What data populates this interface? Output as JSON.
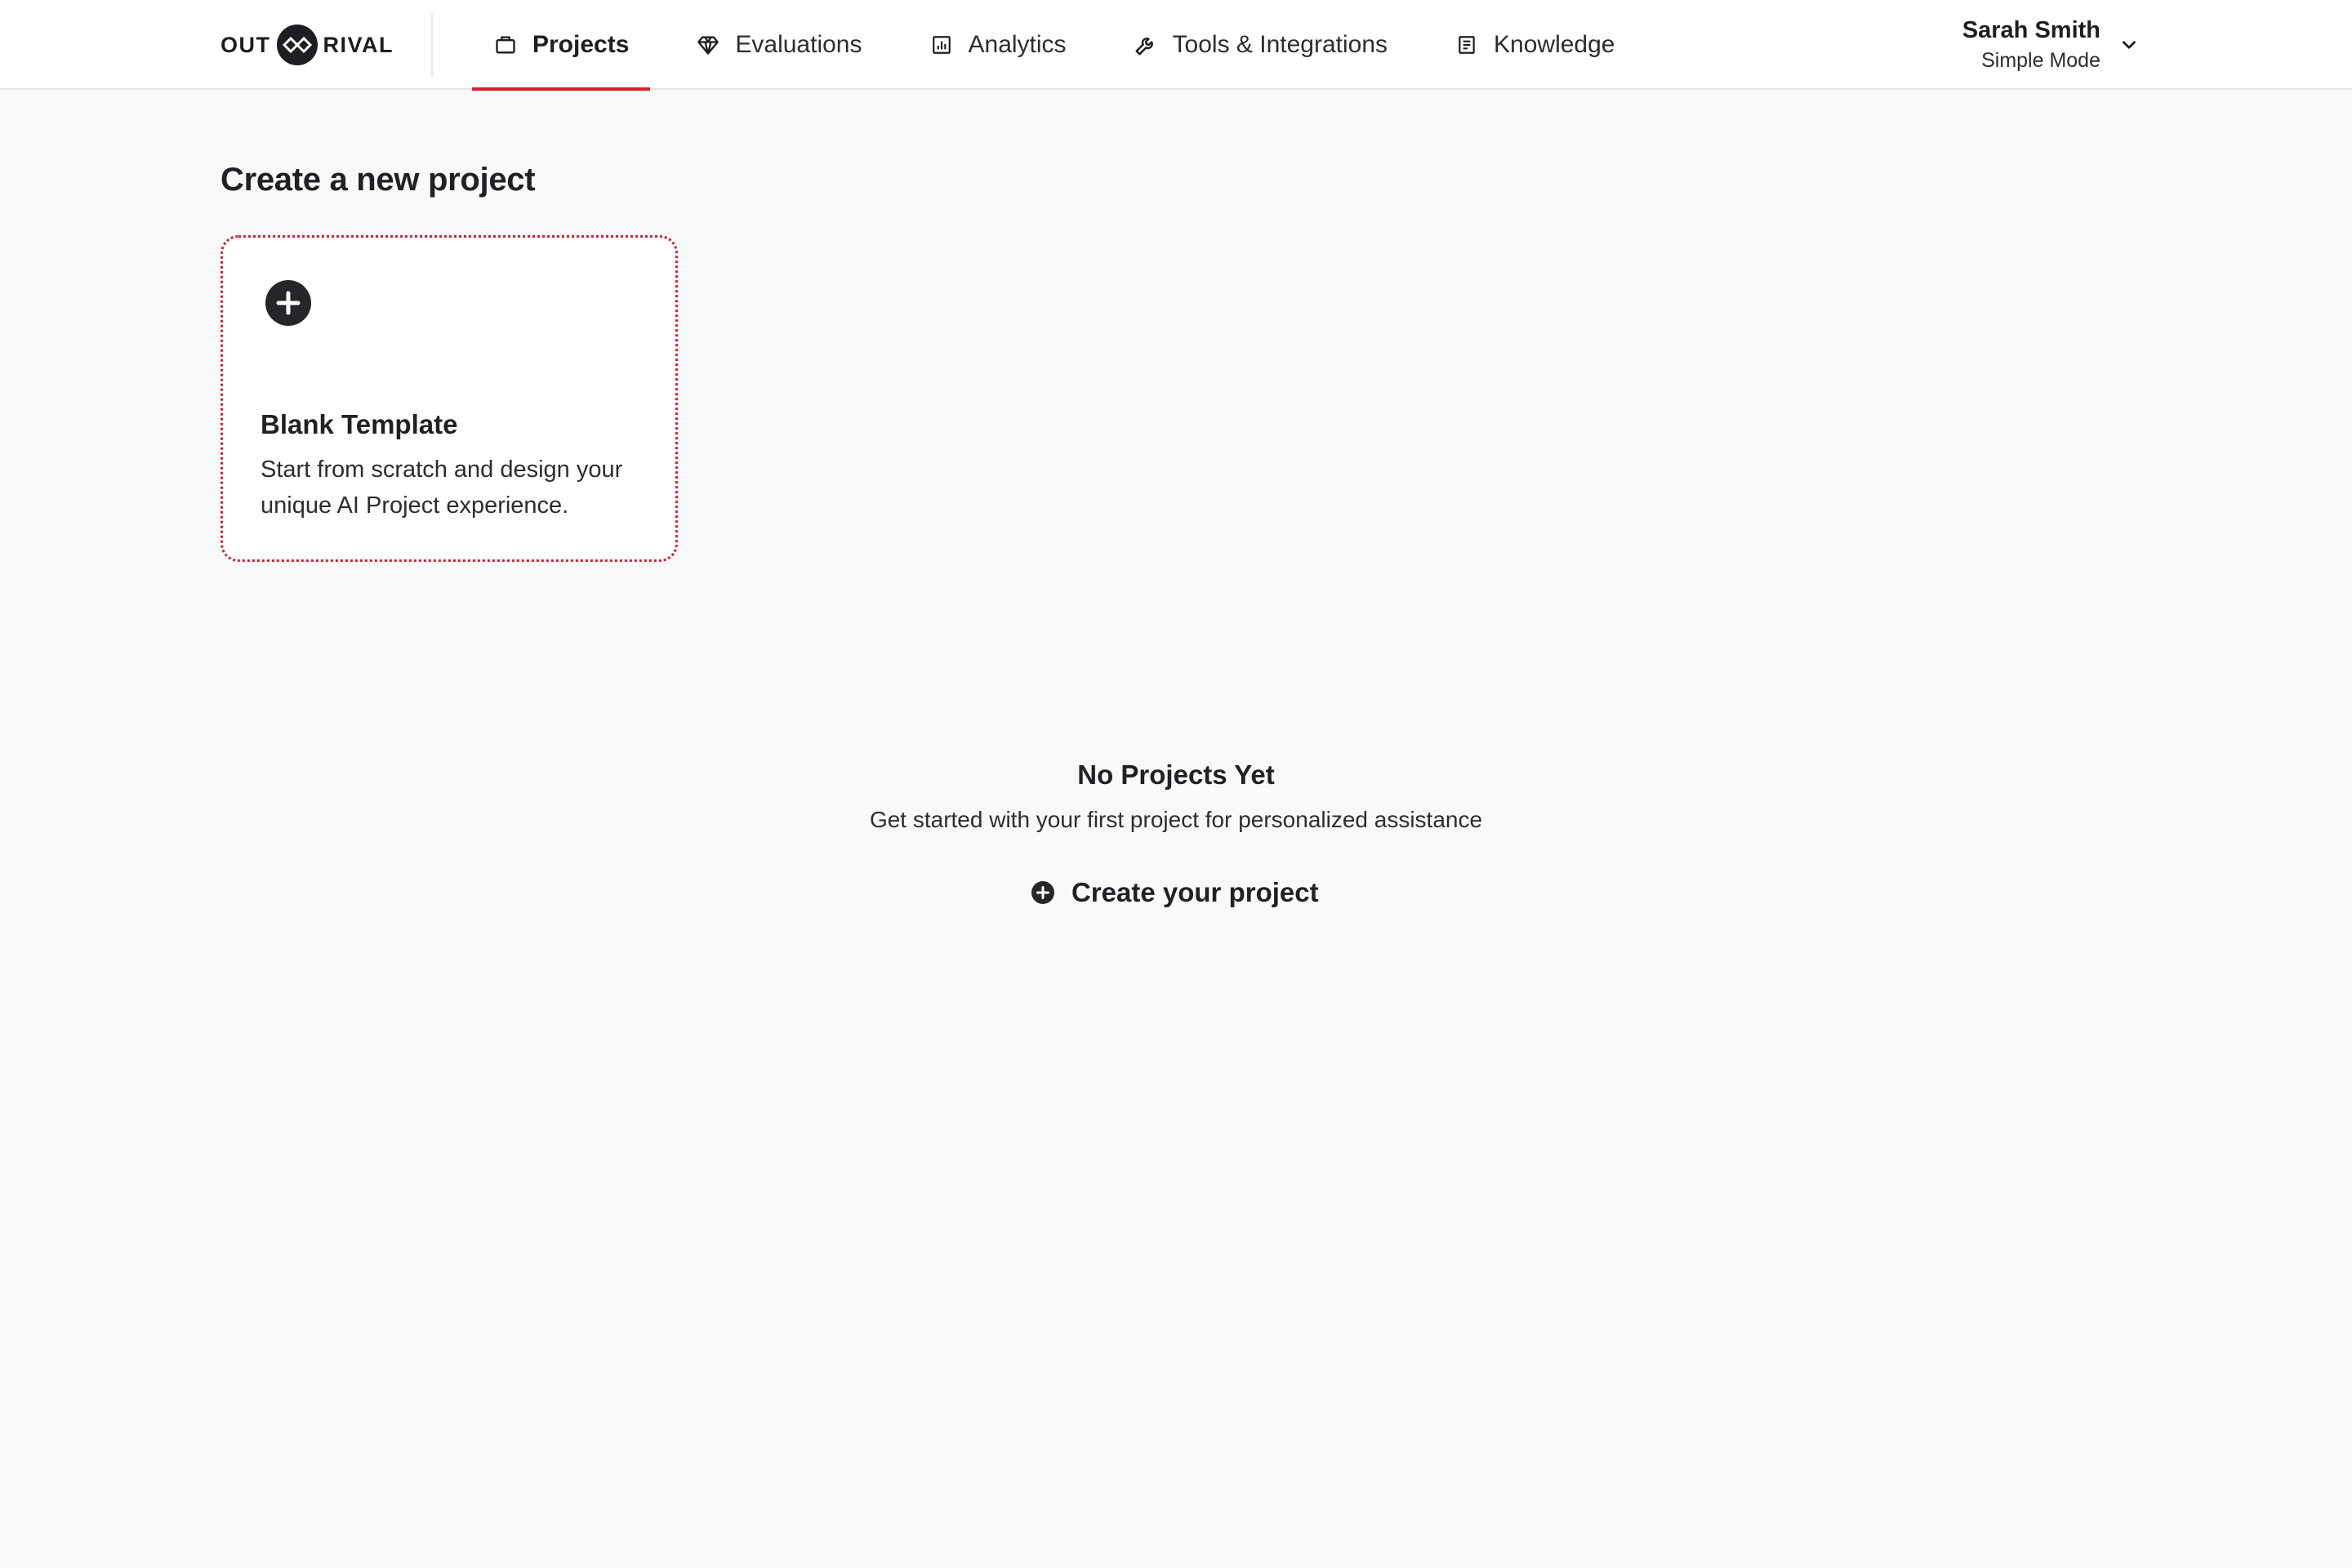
{
  "brand": {
    "left": "OUT",
    "right": "RIVAL"
  },
  "nav": {
    "tabs": [
      {
        "label": "Projects",
        "icon": "briefcase-icon",
        "active": true
      },
      {
        "label": "Evaluations",
        "icon": "diamond-icon",
        "active": false
      },
      {
        "label": "Analytics",
        "icon": "bar-chart-icon",
        "active": false
      },
      {
        "label": "Tools & Integrations",
        "icon": "wrench-icon",
        "active": false
      },
      {
        "label": "Knowledge",
        "icon": "document-icon",
        "active": false
      }
    ]
  },
  "user": {
    "name": "Sarah Smith",
    "mode": "Simple Mode"
  },
  "main": {
    "section_title": "Create a new project",
    "blank_template": {
      "title": "Blank Template",
      "description": "Start from scratch and design your unique AI Project experience."
    },
    "empty_state": {
      "title": "No Projects Yet",
      "subtitle": "Get started with your first project for personalized assistance",
      "cta": "Create your project"
    }
  },
  "colors": {
    "accent": "#d81e2d",
    "text": "#1f2125",
    "background": "#f8f9fa"
  }
}
